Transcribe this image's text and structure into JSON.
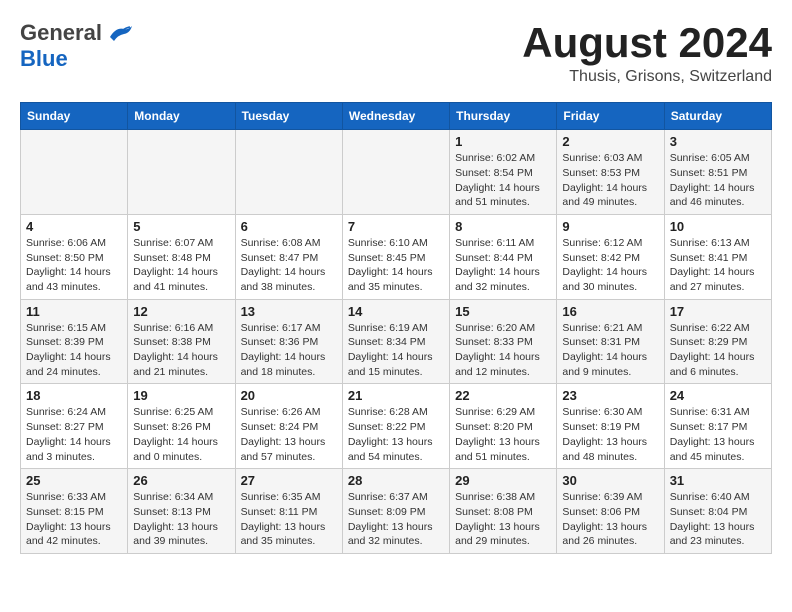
{
  "header": {
    "logo_general": "General",
    "logo_blue": "Blue",
    "month_title": "August 2024",
    "location": "Thusis, Grisons, Switzerland"
  },
  "weekdays": [
    "Sunday",
    "Monday",
    "Tuesday",
    "Wednesday",
    "Thursday",
    "Friday",
    "Saturday"
  ],
  "weeks": [
    [
      {
        "day": "",
        "info": ""
      },
      {
        "day": "",
        "info": ""
      },
      {
        "day": "",
        "info": ""
      },
      {
        "day": "",
        "info": ""
      },
      {
        "day": "1",
        "info": "Sunrise: 6:02 AM\nSunset: 8:54 PM\nDaylight: 14 hours and 51 minutes."
      },
      {
        "day": "2",
        "info": "Sunrise: 6:03 AM\nSunset: 8:53 PM\nDaylight: 14 hours and 49 minutes."
      },
      {
        "day": "3",
        "info": "Sunrise: 6:05 AM\nSunset: 8:51 PM\nDaylight: 14 hours and 46 minutes."
      }
    ],
    [
      {
        "day": "4",
        "info": "Sunrise: 6:06 AM\nSunset: 8:50 PM\nDaylight: 14 hours and 43 minutes."
      },
      {
        "day": "5",
        "info": "Sunrise: 6:07 AM\nSunset: 8:48 PM\nDaylight: 14 hours and 41 minutes."
      },
      {
        "day": "6",
        "info": "Sunrise: 6:08 AM\nSunset: 8:47 PM\nDaylight: 14 hours and 38 minutes."
      },
      {
        "day": "7",
        "info": "Sunrise: 6:10 AM\nSunset: 8:45 PM\nDaylight: 14 hours and 35 minutes."
      },
      {
        "day": "8",
        "info": "Sunrise: 6:11 AM\nSunset: 8:44 PM\nDaylight: 14 hours and 32 minutes."
      },
      {
        "day": "9",
        "info": "Sunrise: 6:12 AM\nSunset: 8:42 PM\nDaylight: 14 hours and 30 minutes."
      },
      {
        "day": "10",
        "info": "Sunrise: 6:13 AM\nSunset: 8:41 PM\nDaylight: 14 hours and 27 minutes."
      }
    ],
    [
      {
        "day": "11",
        "info": "Sunrise: 6:15 AM\nSunset: 8:39 PM\nDaylight: 14 hours and 24 minutes."
      },
      {
        "day": "12",
        "info": "Sunrise: 6:16 AM\nSunset: 8:38 PM\nDaylight: 14 hours and 21 minutes."
      },
      {
        "day": "13",
        "info": "Sunrise: 6:17 AM\nSunset: 8:36 PM\nDaylight: 14 hours and 18 minutes."
      },
      {
        "day": "14",
        "info": "Sunrise: 6:19 AM\nSunset: 8:34 PM\nDaylight: 14 hours and 15 minutes."
      },
      {
        "day": "15",
        "info": "Sunrise: 6:20 AM\nSunset: 8:33 PM\nDaylight: 14 hours and 12 minutes."
      },
      {
        "day": "16",
        "info": "Sunrise: 6:21 AM\nSunset: 8:31 PM\nDaylight: 14 hours and 9 minutes."
      },
      {
        "day": "17",
        "info": "Sunrise: 6:22 AM\nSunset: 8:29 PM\nDaylight: 14 hours and 6 minutes."
      }
    ],
    [
      {
        "day": "18",
        "info": "Sunrise: 6:24 AM\nSunset: 8:27 PM\nDaylight: 14 hours and 3 minutes."
      },
      {
        "day": "19",
        "info": "Sunrise: 6:25 AM\nSunset: 8:26 PM\nDaylight: 14 hours and 0 minutes."
      },
      {
        "day": "20",
        "info": "Sunrise: 6:26 AM\nSunset: 8:24 PM\nDaylight: 13 hours and 57 minutes."
      },
      {
        "day": "21",
        "info": "Sunrise: 6:28 AM\nSunset: 8:22 PM\nDaylight: 13 hours and 54 minutes."
      },
      {
        "day": "22",
        "info": "Sunrise: 6:29 AM\nSunset: 8:20 PM\nDaylight: 13 hours and 51 minutes."
      },
      {
        "day": "23",
        "info": "Sunrise: 6:30 AM\nSunset: 8:19 PM\nDaylight: 13 hours and 48 minutes."
      },
      {
        "day": "24",
        "info": "Sunrise: 6:31 AM\nSunset: 8:17 PM\nDaylight: 13 hours and 45 minutes."
      }
    ],
    [
      {
        "day": "25",
        "info": "Sunrise: 6:33 AM\nSunset: 8:15 PM\nDaylight: 13 hours and 42 minutes."
      },
      {
        "day": "26",
        "info": "Sunrise: 6:34 AM\nSunset: 8:13 PM\nDaylight: 13 hours and 39 minutes."
      },
      {
        "day": "27",
        "info": "Sunrise: 6:35 AM\nSunset: 8:11 PM\nDaylight: 13 hours and 35 minutes."
      },
      {
        "day": "28",
        "info": "Sunrise: 6:37 AM\nSunset: 8:09 PM\nDaylight: 13 hours and 32 minutes."
      },
      {
        "day": "29",
        "info": "Sunrise: 6:38 AM\nSunset: 8:08 PM\nDaylight: 13 hours and 29 minutes."
      },
      {
        "day": "30",
        "info": "Sunrise: 6:39 AM\nSunset: 8:06 PM\nDaylight: 13 hours and 26 minutes."
      },
      {
        "day": "31",
        "info": "Sunrise: 6:40 AM\nSunset: 8:04 PM\nDaylight: 13 hours and 23 minutes."
      }
    ]
  ]
}
